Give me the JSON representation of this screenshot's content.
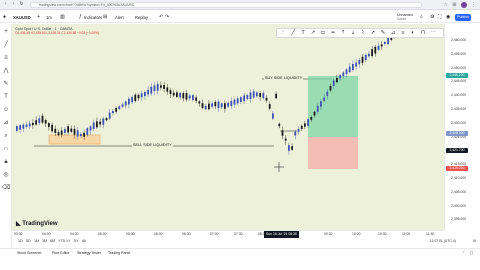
{
  "browser": {
    "url": "tradingview.com/chart/??d5bKu?symbol=FX_IDC%3AXAUUSD"
  },
  "toolbar": {
    "symbol": "XAUUSD",
    "timeframe": "1m",
    "indicators_label": "Indicators",
    "alert_label": "Alert",
    "replay_label": "Replay",
    "layout_name": "Unnamed",
    "saved_status": "Saved",
    "publish_label": "Publish"
  },
  "legend": {
    "title": "Gold Spot / U.S. Dollar · 1 · OANDA",
    "ohlc": "O2,435.45 H2,435.53 L2,435.31 C2,435.58 −0.03 (−0.00%)"
  },
  "annotations": {
    "buy_side": "BUY SIDE LIQUIDITY",
    "sell_side": "SELL SIDE LIQUIDITY"
  },
  "price_axis": {
    "labels": [
      "2,460.000",
      "2,455.000",
      "2,450.000",
      "2,445.000",
      "2,440.000",
      "2,435.000",
      "2,430.000",
      "2,425.000",
      "2,420.000",
      "2,415.000",
      "2,410.000",
      "2,405.000",
      "2,400.000",
      "2,395.000"
    ],
    "tag_green": "2,446.200",
    "tag_blue": "2,428.000",
    "tag_dark": "2,421.700",
    "tag_red": "2,419.200"
  },
  "time_axis": {
    "labels": [
      "03:30",
      "04:00",
      "04:30",
      "05:00",
      "05:30",
      "06:00",
      "06:30",
      "07:00",
      "07:30",
      "08:00",
      "09:30",
      "10:00",
      "10:30",
      "11:00",
      "11:30"
    ],
    "highlight": "Sun 16 Jul '24 08:38"
  },
  "ranges": [
    "1D",
    "5D",
    "1M",
    "3M",
    "6M",
    "YTD",
    "1Y",
    "5Y",
    "All"
  ],
  "clock": "11:07:01 (UTC-4)",
  "bottom_tabs": [
    "Stock Screener",
    "Pine Editor",
    "Strategy Tester",
    "Trading Panel"
  ],
  "branding": "TradingView",
  "colors": {
    "chart_bg": "#eef1d9",
    "bull_candle": "#3f51b5",
    "bear_candle": "#1a1a1a",
    "accent": "#2962ff",
    "target_zone": "#7fd6a6",
    "stop_zone": "#f4a9a8"
  }
}
